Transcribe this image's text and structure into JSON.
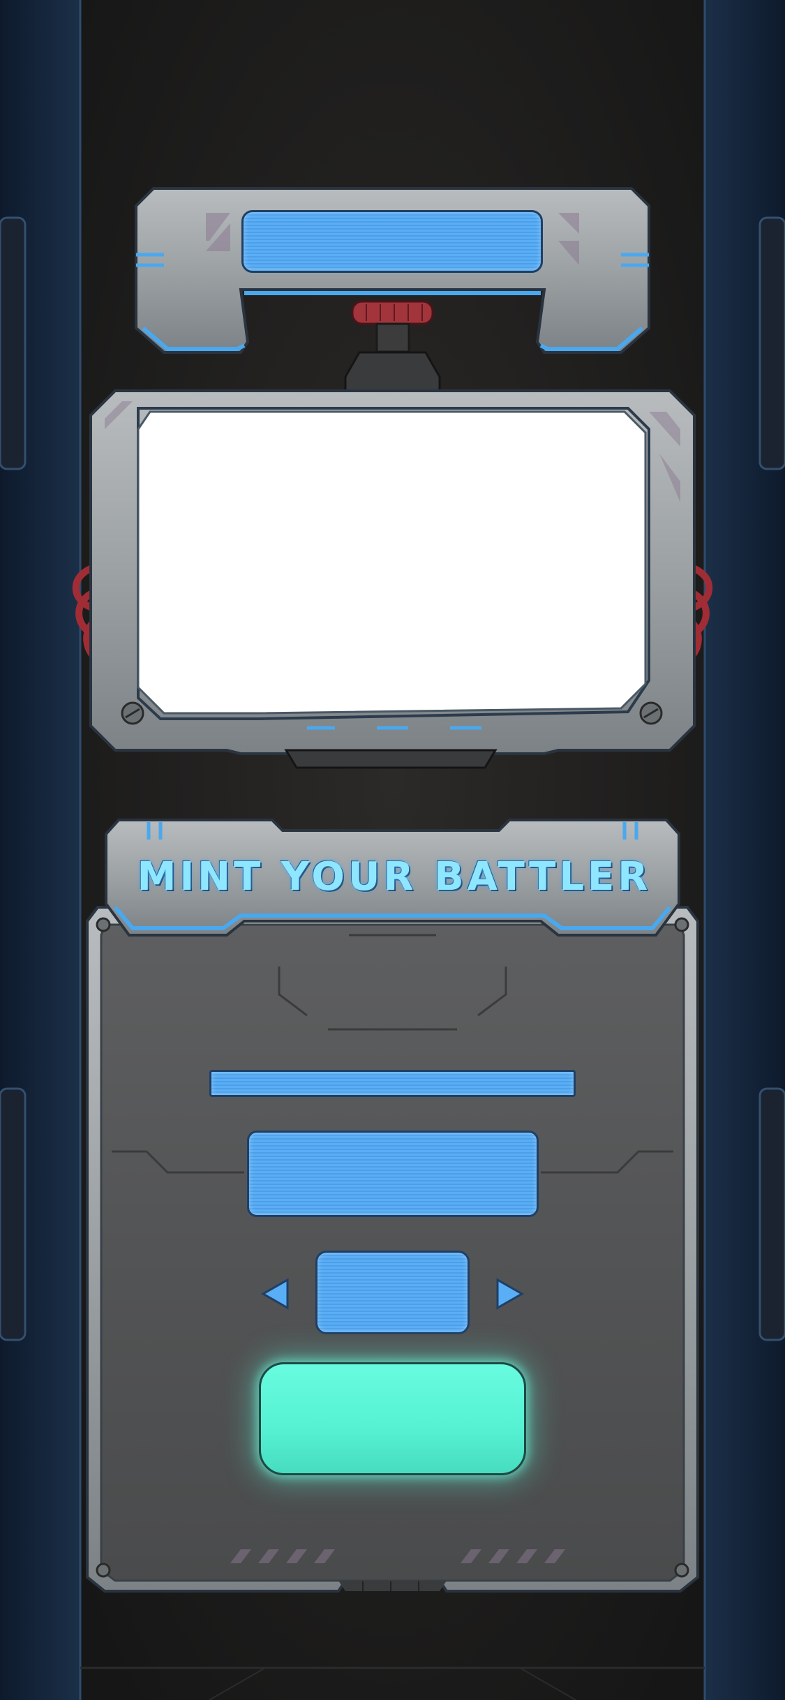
{
  "title_banner": {
    "text": "MINT YOUR BATTLER"
  },
  "colors": {
    "accent_blue": "#5aaef5",
    "mint_green": "#5ff3d6",
    "panel_metal": "#9aa0a3",
    "background": "#15171b",
    "cable_red": "#b03038"
  },
  "icons": {
    "prev": "triangle-left-icon",
    "next": "triangle-right-icon"
  }
}
